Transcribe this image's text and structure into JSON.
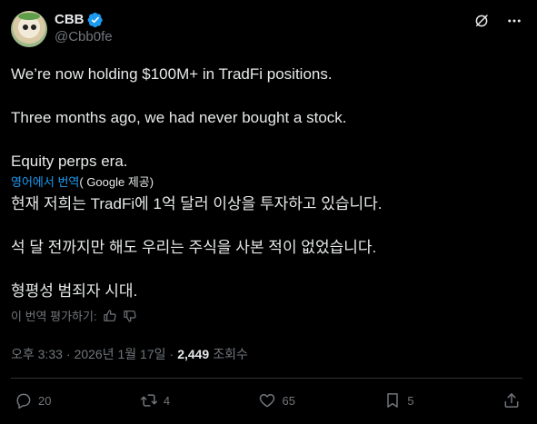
{
  "author": {
    "display_name": "CBB",
    "handle": "@Cbb0fe",
    "avatar_icon": "frog-avatar",
    "verified_color": "#1d9bf0"
  },
  "header_actions": {
    "grok_icon": "grok-icon",
    "more_icon": "more-icon"
  },
  "post": {
    "lines": [
      "We’re now holding $100M+ in TradFi positions.",
      "Three months ago, we had never bought a stock.",
      "Equity perps era."
    ]
  },
  "translation": {
    "link_text": "영어에서 번역",
    "provider_text": "( Google 제공)",
    "lines": [
      "현재 저희는 TradFi에 1억 달러 이상을 투자하고 있습니다.",
      "석 달 전까지만 해도 우리는 주식을 사본 적이 없었습니다.",
      "형평성 범죄자 시대."
    ],
    "rate_label": "이 번역 평가하기:"
  },
  "meta": {
    "time": "오후 3:33",
    "separator": "·",
    "date": "2026년 1월 17일",
    "views_count": "2,449",
    "views_label": "조회수"
  },
  "actions": {
    "replies": "20",
    "reposts": "4",
    "likes": "65",
    "bookmarks": "5"
  },
  "colors": {
    "background": "#000000",
    "text": "#e7e9ea",
    "muted": "#71767b",
    "accent": "#1d9bf0",
    "divider": "#2f3336"
  }
}
